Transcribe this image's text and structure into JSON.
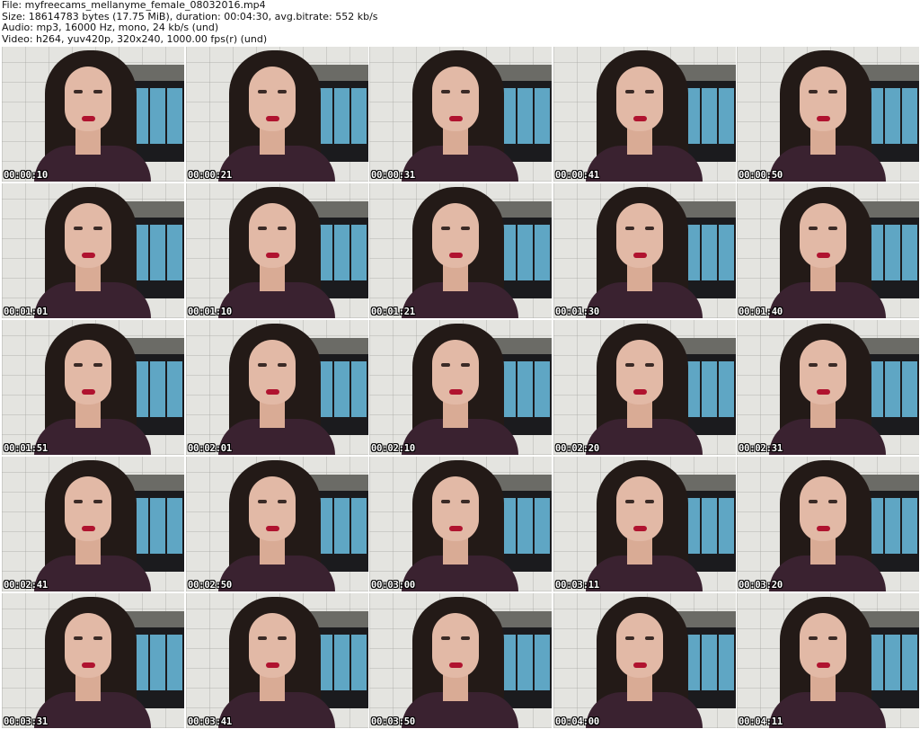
{
  "header": {
    "file": "File: myfreecams_mellanyme_female_08032016.mp4",
    "size": "Size: 18614783 bytes (17.75 MiB), duration: 00:04:30, avg.bitrate: 552 kb/s",
    "audio": "Audio: mp3, 16000 Hz, mono, 24 kb/s (und)",
    "video": "Video: h264, yuv420p, 320x240, 1000.00 fps(r) (und)"
  },
  "thumbnails": [
    "00:00:10",
    "00:00:21",
    "00:00:31",
    "00:00:41",
    "00:00:50",
    "00:01:01",
    "00:01:10",
    "00:01:21",
    "00:01:30",
    "00:01:40",
    "00:01:51",
    "00:02:01",
    "00:02:10",
    "00:02:20",
    "00:02:31",
    "00:02:41",
    "00:02:50",
    "00:03:00",
    "00:03:11",
    "00:03:20",
    "00:03:31",
    "00:03:41",
    "00:03:50",
    "00:04:00",
    "00:04:11"
  ]
}
